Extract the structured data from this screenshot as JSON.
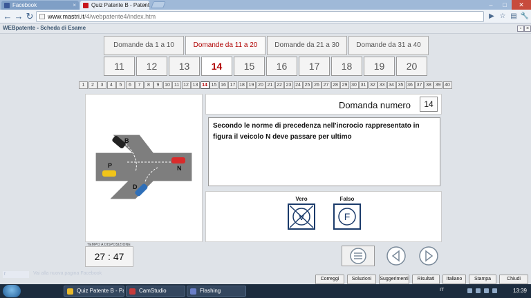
{
  "browser": {
    "tabs": [
      {
        "label": "Facebook"
      },
      {
        "label": "Quiz Patente B - Patente A"
      }
    ],
    "url_host": "www.mastri.it",
    "url_path": "/4/webpatente4/index.htm"
  },
  "app": {
    "title": "WEBpatente - Scheda di Esame",
    "range_tabs": [
      "Domande  da 1 a 10",
      "Domande  da 11 a 20",
      "Domande  da 21 a 30",
      "Domande  da 31 a 40"
    ],
    "active_range": 1,
    "big_numbers": [
      "11",
      "12",
      "13",
      "14",
      "15",
      "16",
      "17",
      "18",
      "19",
      "20"
    ],
    "active_number": "14",
    "small_numbers": [
      "1",
      "2",
      "3",
      "4",
      "5",
      "6",
      "7",
      "8",
      "9",
      "10",
      "11",
      "12",
      "13",
      "14",
      "15",
      "16",
      "17",
      "18",
      "19",
      "20",
      "21",
      "22",
      "23",
      "24",
      "25",
      "26",
      "27",
      "28",
      "29",
      "30",
      "31",
      "32",
      "33",
      "34",
      "35",
      "36",
      "37",
      "38",
      "39",
      "40"
    ],
    "question_label": "Domanda numero",
    "question_number": "14",
    "question_text": "Secondo le norme di precedenza nell'incrocio rappresentato in figura il veicolo N deve passare per ultimo",
    "figure_labels": {
      "b": "B",
      "p": "P",
      "n": "N",
      "d": "D"
    },
    "answer_true_label": "Vero",
    "answer_false_label": "Falso",
    "answer_true_glyph": "V",
    "answer_false_glyph": "F",
    "timer_label": "TEMPO A DISPOSIZIONE",
    "timer_value": "27 : 47",
    "facebook_hint": "Vai alla nuova pagina Facebook",
    "actions": [
      "Correggi",
      "Soluzioni",
      "Suggerimenti",
      "Risultati",
      "Italiano",
      "Stampa",
      "Chiudi"
    ]
  },
  "taskbar": {
    "tasks": [
      "Quiz Patente B - Pat...",
      "CamStudio",
      "Flashing"
    ],
    "lang": "IT",
    "clock": "13:39"
  },
  "colors": {
    "active_red": "#b00000",
    "car_black": "#222222",
    "car_red": "#d92b2b",
    "car_yellow": "#f0c419",
    "car_blue": "#2f6fb8",
    "road_gray": "#7e7e7e"
  }
}
